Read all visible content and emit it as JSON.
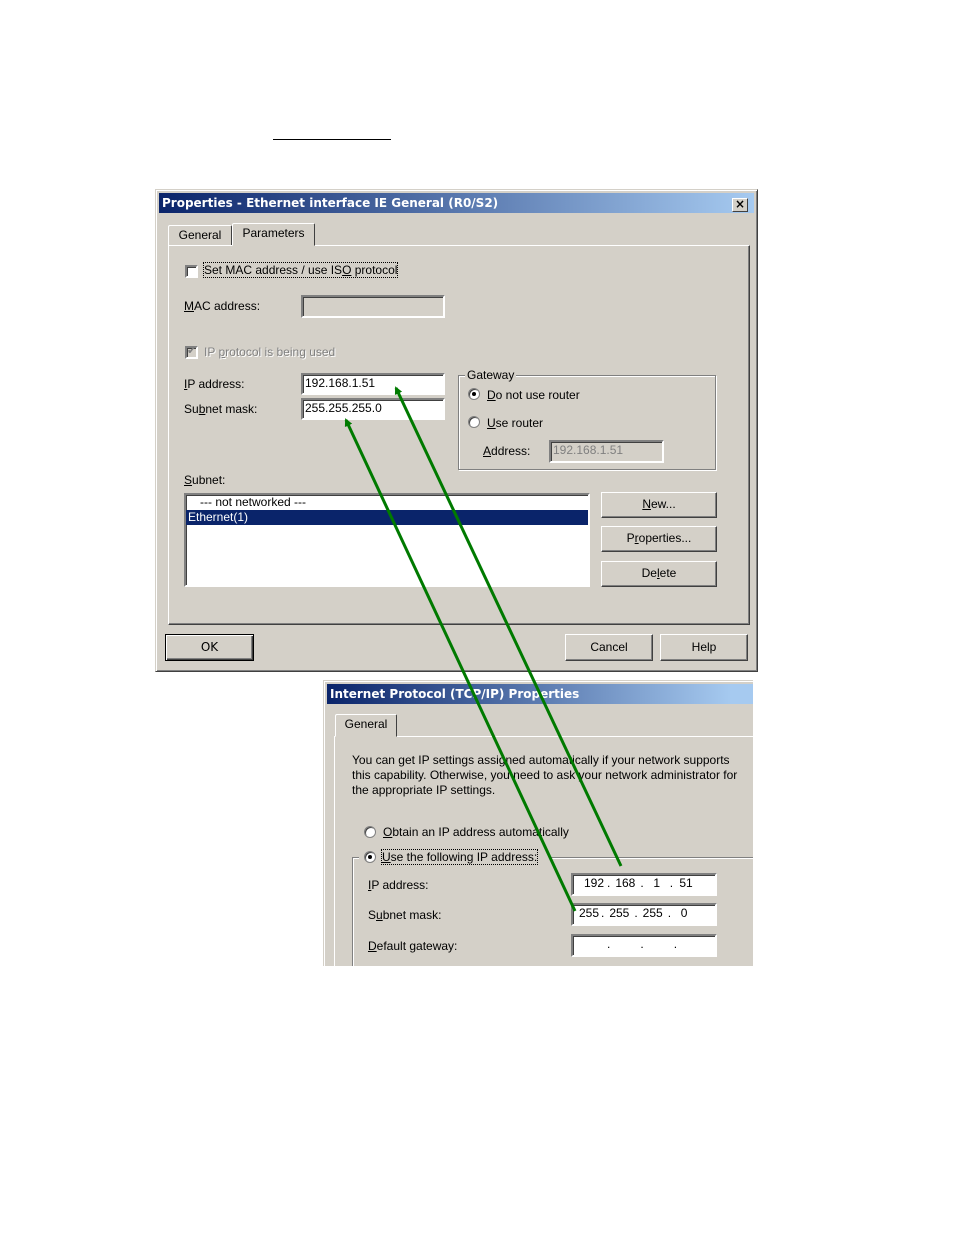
{
  "dialog1": {
    "title": "Properties - Ethernet interface  IE General (R0/S2)",
    "close_label": "✕",
    "tabs": [
      {
        "label": "General",
        "active": false
      },
      {
        "label": "Parameters",
        "active": true
      }
    ],
    "set_mac_checkbox": {
      "label_pre": "Set MAC address / use IS",
      "label_u": "O",
      "label_post": " protocol",
      "checked": false
    },
    "mac_address": {
      "label_u": "M",
      "label_rest": "AC address:",
      "value": "",
      "disabled": true
    },
    "ip_protocol_checkbox": {
      "label_pre": "IP ",
      "label_u": "p",
      "label_post": "rotocol is being used",
      "checked": true,
      "disabled": true
    },
    "ip_address": {
      "label_u": "I",
      "label_rest": "P address:",
      "value": "192.168.1.51"
    },
    "subnet_mask": {
      "label_pre": "Su",
      "label_u": "b",
      "label_rest": "net mask:",
      "value": "255.255.255.0"
    },
    "gateway": {
      "title": "Gateway",
      "options": [
        {
          "label_u": "D",
          "label_rest": "o not use router",
          "selected": true
        },
        {
          "label_u": "U",
          "label_rest": "se router",
          "selected": false
        }
      ],
      "address_label_u": "A",
      "address_label_rest": "ddress:",
      "address_value": "192.168.1.51"
    },
    "subnet": {
      "label_u": "S",
      "label_rest": "ubnet:",
      "items": [
        {
          "label": "--- not networked ---",
          "selected": false
        },
        {
          "label": "Ethernet(1)",
          "selected": true
        }
      ]
    },
    "buttons": {
      "new": {
        "label_u": "N",
        "label_rest": "ew..."
      },
      "properties": {
        "label_pre": "P",
        "label_u": "r",
        "label_rest": "operties..."
      },
      "delete": {
        "label_pre": "De",
        "label_u": "l",
        "label_rest": "ete"
      },
      "ok": "OK",
      "cancel": "Cancel",
      "help": "Help"
    }
  },
  "dialog2": {
    "title": "Internet Protocol (TCP/IP) Properties",
    "tabs": [
      {
        "label": "General",
        "active": true
      }
    ],
    "description": "You can get IP settings assigned automatically if your network supports this capability. Otherwise, you need to ask your network administrator for the appropriate IP settings.",
    "description_lines": [
      "You can get IP settings assigned automatically if your network supports",
      "this capability. Otherwise, you need to ask your network administrator for",
      "the appropriate IP settings."
    ],
    "obtain_auto": {
      "label_u": "O",
      "label_rest": "btain an IP address automatically",
      "selected": false
    },
    "use_following": {
      "label_u": "U",
      "label_pre": "",
      "label_rest": "se the following IP address:",
      "selected": true,
      "label_full": "Use the following IP address:"
    },
    "ip_address": {
      "label_u": "I",
      "label_rest": "P address:",
      "octets": [
        "192",
        "168",
        "1",
        "51"
      ]
    },
    "subnet_mask": {
      "label_pre": "S",
      "label_u": "u",
      "label_rest": "bnet mask:",
      "octets": [
        "255",
        "255",
        "255",
        "0"
      ]
    },
    "default_gateway": {
      "label_u": "D",
      "label_rest": "efault gateway:",
      "octets": [
        "",
        "",
        "",
        ""
      ]
    }
  },
  "annotations": {
    "arrow_color": "#007a00",
    "arrows": [
      {
        "from": "dialog2.ip_address",
        "to": "dialog1.ip_address"
      },
      {
        "from": "dialog2.subnet_mask",
        "to": "dialog1.subnet_mask"
      }
    ]
  }
}
